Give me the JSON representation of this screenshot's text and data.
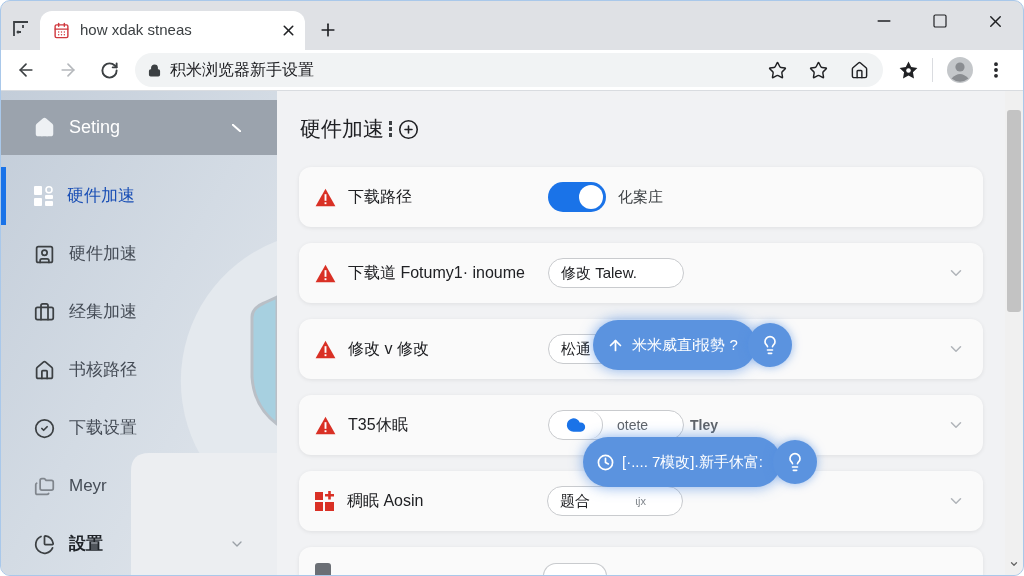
{
  "browser": {
    "tabs": [
      {
        "title": "how xdak stneas",
        "selected": true
      }
    ],
    "nav": [
      {
        "kind": "back",
        "disabled": false
      },
      {
        "kind": "forward",
        "disabled": true
      },
      {
        "kind": "reload",
        "disabled": false
      }
    ],
    "address": "积米浏览器新手设置"
  },
  "sidebar": {
    "header": "Seting",
    "items": [
      {
        "label": "硬件加速",
        "kind": "link",
        "selected": true
      },
      {
        "label": "硬件加速",
        "kind": "link",
        "selected": false
      },
      {
        "label": "经集加速",
        "kind": "link",
        "selected": false
      },
      {
        "label": "书核路径",
        "kind": "link",
        "selected": false
      },
      {
        "label": "下载设置",
        "kind": "link",
        "selected": false
      },
      {
        "label": "Meyr",
        "kind": "link",
        "selected": false
      },
      {
        "label": "設置",
        "kind": "group",
        "selected": false
      }
    ]
  },
  "main": {
    "title": "硬件加速",
    "cards": [
      {
        "kind": "toggle",
        "label": "下载路径",
        "on": true,
        "value_label": "化案庄"
      },
      {
        "kind": "field",
        "label": "下载道 Fotumy1· inoume",
        "value": "修改 Talew."
      },
      {
        "kind": "field",
        "label": "修改 v 修改",
        "value": "松通"
      },
      {
        "kind": "segmented",
        "label": "T35休眠",
        "option_label": "otete",
        "side_label": "Tley"
      },
      {
        "kind": "field",
        "label": "稠眠 Aosin",
        "value": "题合",
        "hint": "ɩjx"
      },
      {
        "kind": "partial"
      }
    ],
    "tooltips": [
      {
        "text": "米米威直i报勢 ?"
      },
      {
        "text": "[·.... 7模改].新手休富:"
      }
    ]
  }
}
